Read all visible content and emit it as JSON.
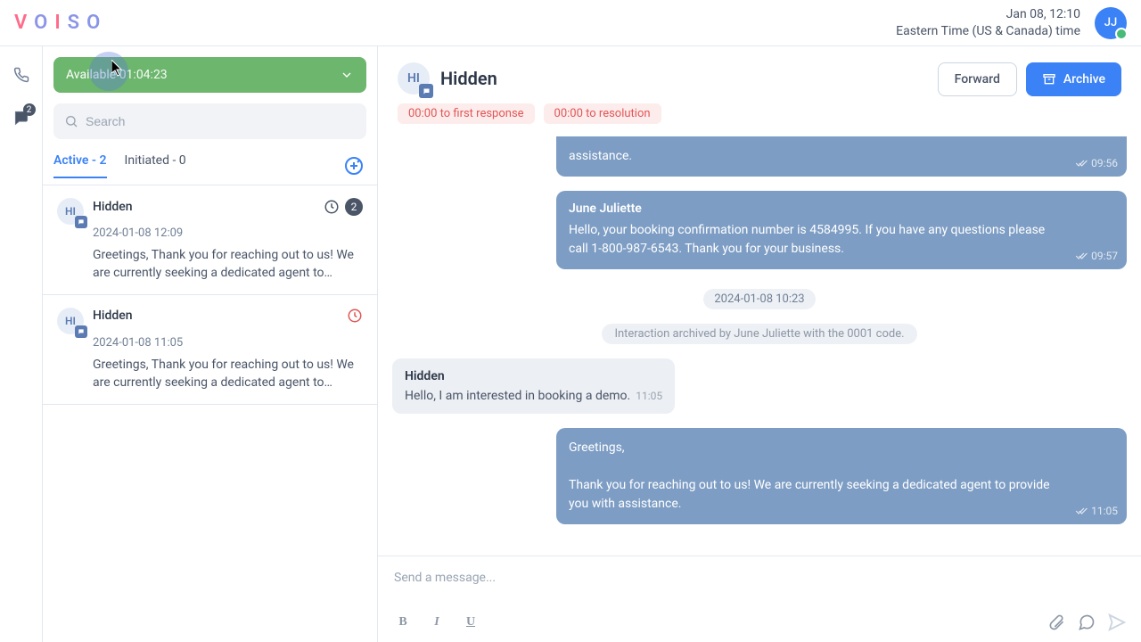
{
  "header": {
    "logo_letters": [
      "V",
      "O",
      "I",
      "S",
      "O"
    ],
    "datetime": "Jan 08, 12:10",
    "timezone": "Eastern Time (US & Canada) time",
    "user_initials": "JJ"
  },
  "leftrail": {
    "chats_badge": "2"
  },
  "sidebar": {
    "status_label": "Available",
    "status_timer": "01:04:23",
    "search_placeholder": "Search",
    "tab_active_label": "Active - 2",
    "tab_initiated_label": "Initiated - 0",
    "conversations": [
      {
        "avatar": "HI",
        "name": "Hidden",
        "timestamp": "2024-01-08 12:09",
        "preview": "Greetings, Thank you for reaching out to us! We are currently seeking a dedicated agent to provide…",
        "unread": "2",
        "show_clock": true,
        "clock_color": "#4a5568"
      },
      {
        "avatar": "HI",
        "name": "Hidden",
        "timestamp": "2024-01-08 11:05",
        "preview": "Greetings, Thank you for reaching out to us! We are currently seeking a dedicated agent to provide…",
        "unread": "",
        "show_clock": true,
        "clock_color": "#e25656"
      }
    ]
  },
  "main": {
    "contact_avatar": "HI",
    "contact_name": "Hidden",
    "btn_forward": "Forward",
    "btn_archive": "Archive",
    "alert_first_response": "00:00 to first response",
    "alert_resolution": "00:00 to resolution"
  },
  "messages": {
    "m0_body_tail": "assistance.",
    "m0_time": "09:56",
    "m1_sender": "June Juliette",
    "m1_body": "Hello, your booking confirmation number is 4584995. If you have any questions please call 1-800-987-6543. Thank you for your business.",
    "m1_time": "09:57",
    "date_sep": "2024-01-08 10:23",
    "sys_note": "Interaction archived by June Juliette with the 0001 code.",
    "m2_sender": "Hidden",
    "m2_body": "Hello, I am interested in booking a demo.",
    "m2_time": "11:05",
    "m3_greet": "Greetings,",
    "m3_body": "Thank you for reaching out to us! We are currently seeking a dedicated agent to provide you with assistance.",
    "m3_time": "11:05"
  },
  "composer": {
    "placeholder": "Send a message..."
  }
}
